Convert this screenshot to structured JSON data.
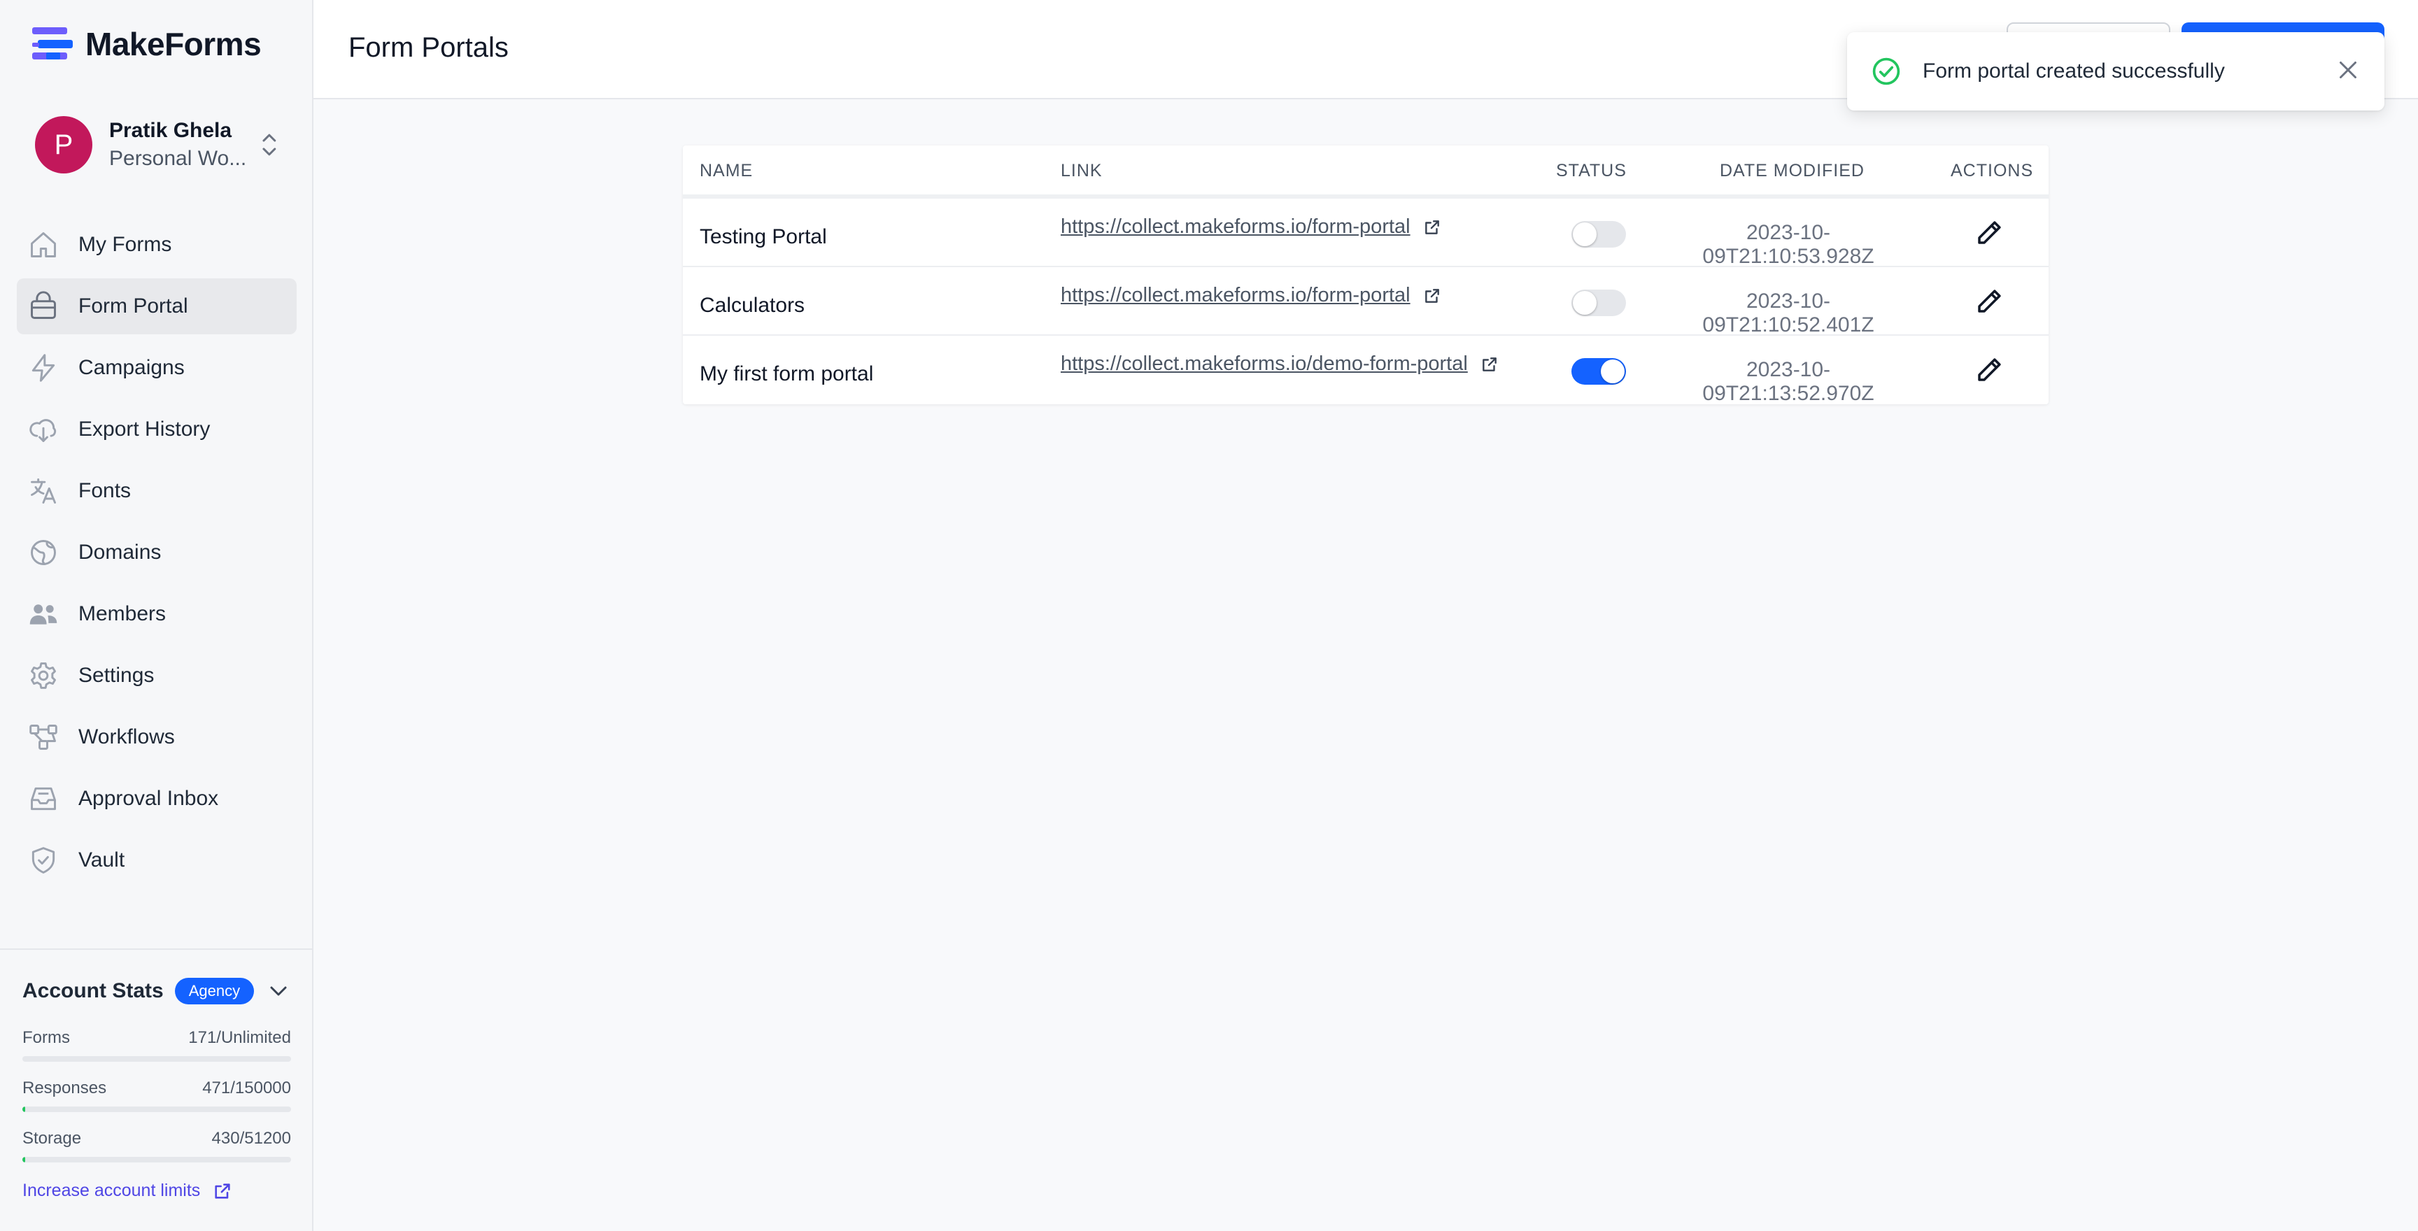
{
  "app": {
    "name": "MakeForms"
  },
  "user": {
    "initial": "P",
    "name": "Pratik Ghela",
    "workspace": "Personal Wo..."
  },
  "sidebar": {
    "items": [
      {
        "label": "My Forms",
        "icon": "home-icon"
      },
      {
        "label": "Form Portal",
        "icon": "portal-icon",
        "active": true
      },
      {
        "label": "Campaigns",
        "icon": "bolt-icon"
      },
      {
        "label": "Export History",
        "icon": "cloud-download-icon"
      },
      {
        "label": "Fonts",
        "icon": "translate-icon"
      },
      {
        "label": "Domains",
        "icon": "globe-icon"
      },
      {
        "label": "Members",
        "icon": "users-icon"
      },
      {
        "label": "Settings",
        "icon": "gear-icon"
      },
      {
        "label": "Workflows",
        "icon": "workflow-icon"
      },
      {
        "label": "Approval Inbox",
        "icon": "inbox-icon"
      },
      {
        "label": "Vault",
        "icon": "shield-icon"
      }
    ]
  },
  "stats": {
    "title": "Account Stats",
    "badge": "Agency",
    "items": [
      {
        "label": "Forms",
        "value": "171/Unlimited",
        "fraction": 0
      },
      {
        "label": "Responses",
        "value": "471/150000",
        "fraction": 0.0031
      },
      {
        "label": "Storage",
        "value": "430/51200",
        "fraction": 0.0084
      }
    ],
    "increase_label": "Increase account limits"
  },
  "header": {
    "title": "Form Portals"
  },
  "table": {
    "columns": [
      "NAME",
      "LINK",
      "STATUS",
      "DATE MODIFIED",
      "ACTIONS"
    ],
    "rows": [
      {
        "name": "Testing Portal",
        "link": "https://collect.makeforms.io/form-portal",
        "status": false,
        "date": "2023-10-09T21:10:53.928Z"
      },
      {
        "name": "Calculators",
        "link": "https://collect.makeforms.io/form-portal",
        "status": false,
        "date": "2023-10-09T21:10:52.401Z"
      },
      {
        "name": "My first form portal",
        "link": "https://collect.makeforms.io/demo-form-portal",
        "status": true,
        "date": "2023-10-09T21:13:52.970Z"
      }
    ]
  },
  "toast": {
    "message": "Form portal created successfully"
  },
  "colors": {
    "primary": "#1462ff",
    "avatar": "#c2185b",
    "success": "#22c55e",
    "link_accent": "#4f46e5"
  }
}
